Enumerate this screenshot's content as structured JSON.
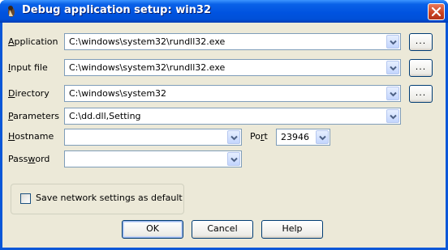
{
  "window": {
    "title": "Debug application setup: win32",
    "icon": "ida-debugger-icon",
    "close_icon": "close-icon"
  },
  "fields": {
    "application": {
      "label_pre": "",
      "label_key": "A",
      "label_post": "pplication",
      "value": "C:\\windows\\system32\\rundll32.exe",
      "browse": "..."
    },
    "input_file": {
      "label_pre": "",
      "label_key": "I",
      "label_post": "nput file",
      "value": "C:\\windows\\system32\\rundll32.exe",
      "browse": "..."
    },
    "directory": {
      "label_pre": "",
      "label_key": "D",
      "label_post": "irectory",
      "value": "C:\\windows\\system32",
      "browse": "..."
    },
    "parameters": {
      "label_pre": "",
      "label_key": "P",
      "label_post": "arameters",
      "value": "C:\\dd.dll,Setting"
    },
    "hostname": {
      "label_pre": "",
      "label_key": "H",
      "label_post": "ostname",
      "value": ""
    },
    "port": {
      "label_pre": "Po",
      "label_key": "r",
      "label_post": "t",
      "value": "23946"
    },
    "password": {
      "label_pre": "Pass",
      "label_key": "w",
      "label_post": "ord",
      "value": ""
    }
  },
  "save_network_settings": {
    "label": "Save network settings as default",
    "checked": false
  },
  "buttons": {
    "ok": "OK",
    "cancel": "Cancel",
    "help": "Help"
  }
}
